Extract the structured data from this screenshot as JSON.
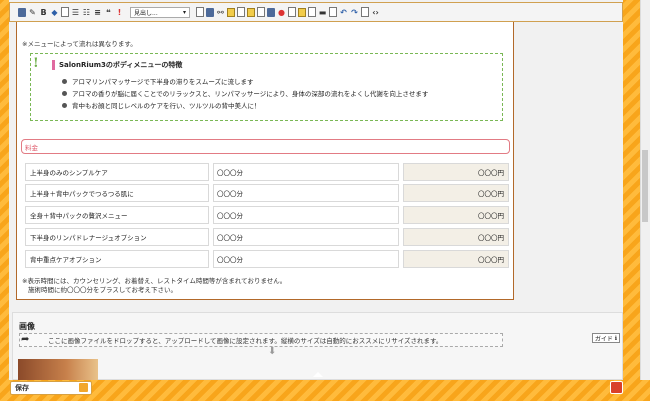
{
  "toolbar": {
    "bold_label": "B",
    "quote_label": "❝",
    "heading_select": "見出し..."
  },
  "editor": {
    "menu_note": "※メニューによって流れは異なります。",
    "features": {
      "title": "SalonRium3のボディメニューの特徴",
      "items": [
        "アロマリンパマッサージで下半身の滞りをスムーズに流します",
        "アロマの香りが脳に届くことでのリラックスと、リンパマッサージにより、身体の深部の流れをよくし代謝を向上させます",
        "背中もお顔と同じレベルのケアを行い、ツルツルの背中美人に！"
      ]
    },
    "price_header": "料金",
    "price_rows": [
      {
        "name": "上半身のみのシンプルケア",
        "time": "〇〇〇分",
        "price": "〇〇〇円"
      },
      {
        "name": "上半身＋背中パックでつるつる肌に",
        "time": "〇〇〇分",
        "price": "〇〇〇円"
      },
      {
        "name": "全身＋背中パックの贅沢メニュー",
        "time": "〇〇〇分",
        "price": "〇〇〇円"
      },
      {
        "name": "下半身のリンパドレナージュオプション",
        "time": "〇〇〇分",
        "price": "〇〇〇円"
      },
      {
        "name": "背中重点ケアオプション",
        "time": "〇〇〇分",
        "price": "〇〇〇円"
      }
    ],
    "time_note_1": "※表示時間には、カウンセリング、お着替え、レストタイム時間等が含まれておりません。",
    "time_note_2": "施術時間に約〇〇〇分をプラスしてお考え下さい。"
  },
  "image_section": {
    "heading": "画像",
    "drop_text": "ここに画像ファイルをドロップすると、アップロードして画像に設定されます。縦横のサイズは自動的におススメにリサイズされます。",
    "guide_label": "ガイド"
  },
  "footer": {
    "save_label": "保存"
  },
  "colors": {
    "accent_orange": "#f8a51b",
    "border_brown": "#b2692a",
    "feature_green": "#7ab855",
    "price_pink": "#e27b84",
    "trash_red": "#d9402a"
  }
}
